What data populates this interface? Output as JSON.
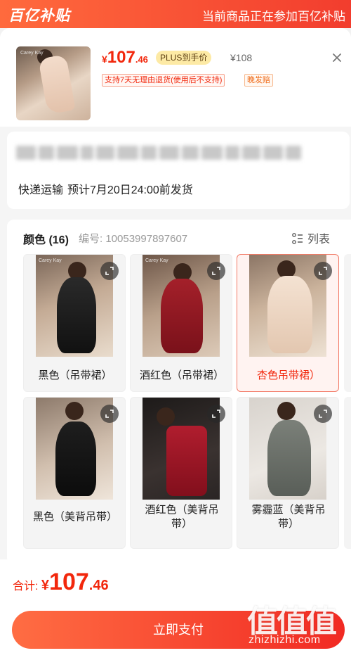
{
  "topbar": {
    "brand": "百亿补贴",
    "notice": "当前商品正在参加百亿补贴"
  },
  "product": {
    "price_symbol": "¥",
    "price_int": "107",
    "price_dec": ".46",
    "plus_tag": "PLUS到手价",
    "original_price": "¥108",
    "return_tag": "支持7天无理由退货(使用后不支持)",
    "late_tag": "晚发赔",
    "thumb_brand": "Carey Kay"
  },
  "shipping": {
    "method": "快递运输",
    "estimate": "预计7月20日24:00前发货"
  },
  "variants": {
    "title": "颜色 (16)",
    "sku_label": "编号:",
    "sku_value": "10053997897607",
    "list_label": "列表",
    "options": [
      {
        "label": "黑色（吊带裙）",
        "selected": false,
        "brand": "Carey Kay"
      },
      {
        "label": "酒红色（吊带裙）",
        "selected": false,
        "brand": "Carey Kay"
      },
      {
        "label": "杏色吊带裙）",
        "selected": true,
        "brand": ""
      },
      {
        "label": "黑色（美背吊带）",
        "selected": false,
        "brand": ""
      },
      {
        "label": "酒红色（美背吊带）",
        "selected": false,
        "brand": ""
      },
      {
        "label": "雾霾蓝（美背吊带）",
        "selected": false,
        "brand": ""
      }
    ]
  },
  "footer": {
    "total_label": "合计:",
    "total_symbol": "¥",
    "total_int": "107",
    "total_dec": ".46",
    "pay_button": "立即支付"
  },
  "watermark": {
    "chars": "值值值",
    "url": "zhizhizhi.com"
  },
  "colors": {
    "accent": "#f2270c",
    "brand_gradient_start": "#ff6a3d",
    "brand_gradient_end": "#f23d2e",
    "plus_tag_bg": "#fdeaa5"
  }
}
